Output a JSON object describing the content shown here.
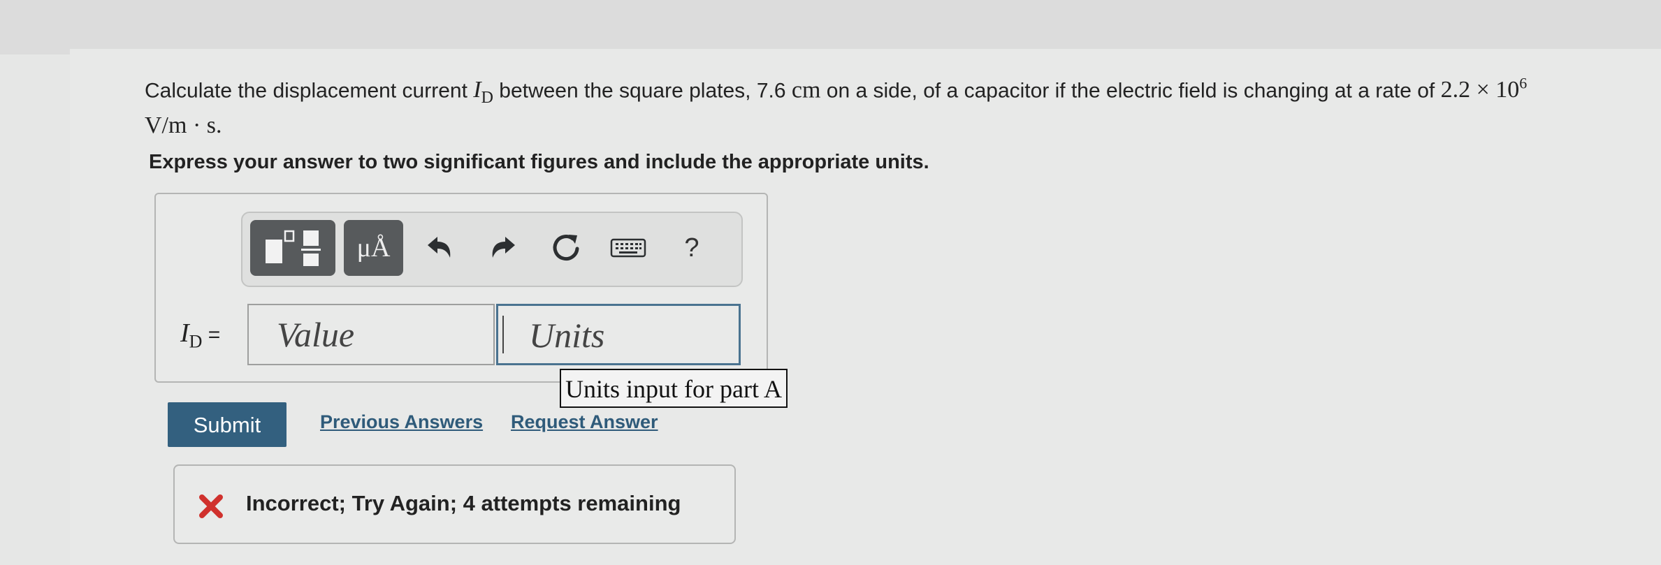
{
  "question": {
    "text_before": "Calculate the displacement current ",
    "symbol_I": "I",
    "symbol_sub": "D",
    "text_mid": " between the square plates, 7.6 ",
    "unit_cm": "cm",
    "text_after": " on a side, of a capacitor if the electric field is changing at a rate of ",
    "rate_mantissa": "2.2",
    "times": "×",
    "rate_base": "10",
    "rate_exp": "6",
    "rate_units": "V/m · s",
    "period": "."
  },
  "instruction": "Express your answer to two significant figures and include the appropriate units.",
  "toolbar": {
    "units_label": "μÅ",
    "help_label": "?"
  },
  "answer": {
    "label_I": "I",
    "label_sub": "D",
    "equals": " =",
    "value_placeholder": "Value",
    "units_placeholder": "Units",
    "tooltip": "Units input for part A"
  },
  "actions": {
    "submit": "Submit",
    "previous_answers": "Previous Answers",
    "request_answer": "Request Answer"
  },
  "feedback": {
    "status": "Incorrect",
    "message": "Incorrect; Try Again; 4 attempts remaining"
  },
  "colors": {
    "submit_bg": "#33607f",
    "link": "#2f5b7a",
    "error_icon": "#d0312d",
    "focus_border": "#4a7390"
  },
  "icons": [
    "templates-icon",
    "undo-icon",
    "redo-icon",
    "reset-icon",
    "keyboard-icon",
    "help-icon",
    "incorrect-x-icon"
  ]
}
